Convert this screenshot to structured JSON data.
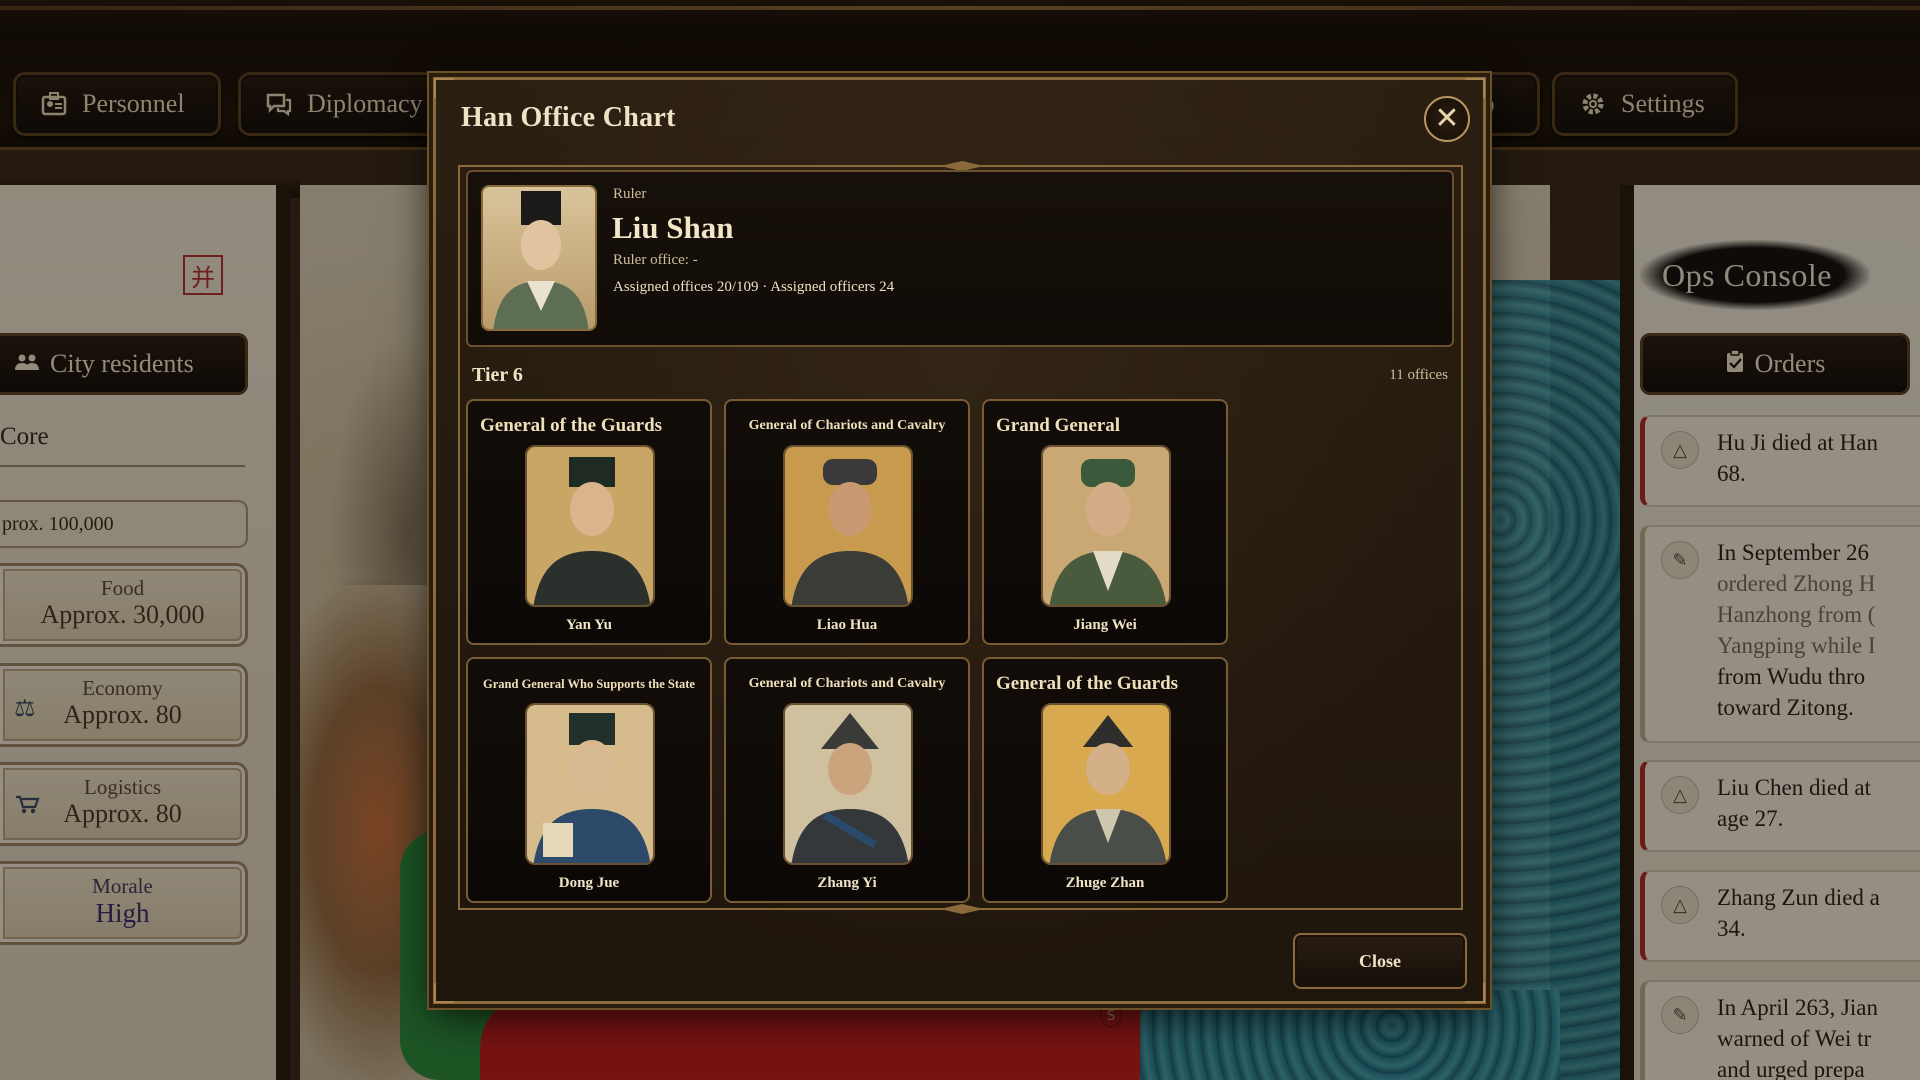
{
  "topbar": {
    "personnel_label": "Personnel",
    "diplomacy_label": "Diplomacy",
    "info_partial_label": "fo",
    "settings_label": "Settings"
  },
  "left_panel": {
    "seal_glyph": "并",
    "city_residents_label": "City residents",
    "core_label": "Core",
    "population_text": "prox. 100,000",
    "stats": [
      {
        "label": "Food",
        "value": "Approx. 30,000"
      },
      {
        "label": "Economy",
        "value": "Approx. 80"
      },
      {
        "label": "Logistics",
        "value": "Approx. 80"
      },
      {
        "label": "Morale",
        "value": "High"
      }
    ]
  },
  "right_panel": {
    "title": "Ops Console",
    "orders_label": "Orders",
    "events": [
      {
        "lines": [
          "Hu Ji died at Han",
          "68."
        ],
        "icon": "warning-icon"
      },
      {
        "lines": [
          "In September 26",
          "ordered Zhong H",
          "Hanzhong from (",
          "Yangping while I",
          "from Wudu thro",
          "toward Zitong."
        ],
        "icon": "scroll-icon"
      },
      {
        "lines": [
          "Liu Chen died at",
          "age 27."
        ],
        "icon": "warning-icon"
      },
      {
        "lines": [
          "Zhang Zun died a",
          "34."
        ],
        "icon": "warning-icon"
      },
      {
        "lines": [
          "In April 263, Jian",
          "warned of Wei tr",
          "and urged prepa"
        ],
        "icon": "scroll-icon"
      }
    ]
  },
  "map": {
    "marker_text": "S"
  },
  "modal": {
    "title": "Han Office Chart",
    "close_label": "Close",
    "ruler": {
      "type_label": "Ruler",
      "name": "Liu Shan",
      "office_text": "Ruler office: -",
      "stats_text": "Assigned offices 20/109 · Assigned officers 24"
    },
    "tier": {
      "label": "Tier 6",
      "count_text": "11 offices"
    },
    "offices": [
      {
        "title": "General of the Guards",
        "officer": "Yan Yu"
      },
      {
        "title": "General of Chariots and Cavalry",
        "officer": "Liao Hua"
      },
      {
        "title": "Grand General",
        "officer": "Jiang Wei"
      },
      {
        "title": "Grand General Who Supports the State",
        "officer": "Dong Jue"
      },
      {
        "title": "General of Chariots and Cavalry",
        "officer": "Zhang Yi"
      },
      {
        "title": "General of the Guards",
        "officer": "Zhuge Zhan"
      }
    ]
  },
  "colors": {
    "accent_gold": "#8a6a3a",
    "text_cream": "#efe3c6",
    "alert_red": "#b02a22"
  }
}
